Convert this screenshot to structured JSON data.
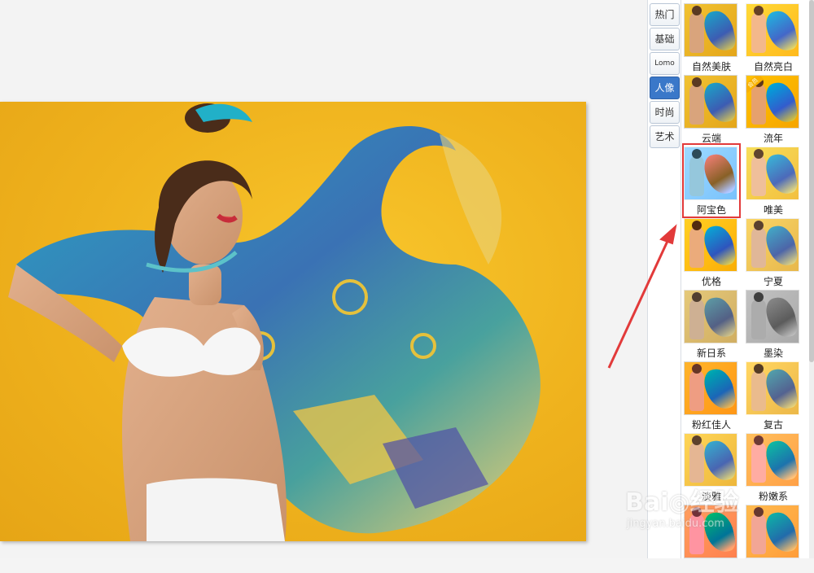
{
  "tabs": [
    "热门",
    "基础",
    "Lomo",
    "人像",
    "时尚",
    "艺术"
  ],
  "active_tab": "人像",
  "filters": [
    {
      "name": "自然美肤"
    },
    {
      "name": "自然亮白"
    },
    {
      "name": "云端"
    },
    {
      "name": "流年",
      "badge": "会员"
    },
    {
      "name": "阿宝色",
      "highlighted": true
    },
    {
      "name": "唯美"
    },
    {
      "name": "优格"
    },
    {
      "name": "宁夏"
    },
    {
      "name": "新日系"
    },
    {
      "name": "墨染"
    },
    {
      "name": "粉红佳人"
    },
    {
      "name": "复古"
    },
    {
      "name": "淡雅"
    },
    {
      "name": "粉嫩系"
    },
    {
      "name": ""
    },
    {
      "name": ""
    }
  ],
  "watermark": {
    "logo": "Bai◎经验",
    "url": "jingyan.baidu.com"
  },
  "colors": {
    "highlight": "#e23a3a",
    "active_tab": "#3a78c9",
    "photo_bg": "#efb21d"
  }
}
